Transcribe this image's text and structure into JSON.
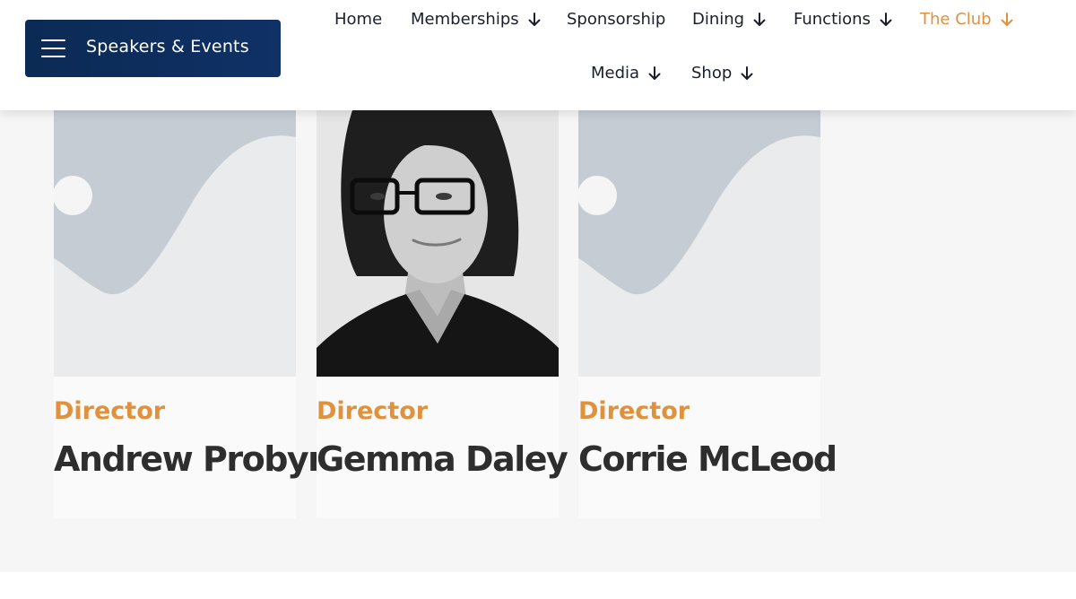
{
  "header": {
    "menu_button": {
      "label": "Speakers & Events",
      "icon": "hamburger-icon",
      "bg_color": "#0b2a54"
    },
    "nav": [
      {
        "label": "Home",
        "has_dropdown": false,
        "active": false
      },
      {
        "label": "Memberships",
        "has_dropdown": true,
        "active": false
      },
      {
        "label": "Sponsorship",
        "has_dropdown": false,
        "active": false
      },
      {
        "label": "Dining",
        "has_dropdown": true,
        "active": false
      },
      {
        "label": "Functions",
        "has_dropdown": true,
        "active": false
      },
      {
        "label": "The Club",
        "has_dropdown": true,
        "active": true
      },
      {
        "label": "Media",
        "has_dropdown": true,
        "active": false
      },
      {
        "label": "Shop",
        "has_dropdown": true,
        "active": false
      }
    ],
    "accent_color": "#e0913c"
  },
  "people": [
    {
      "role": "Director",
      "name": "Andrew Probyn",
      "image": "placeholder-avatar"
    },
    {
      "role": "Director",
      "name": "Gemma Daley",
      "image": "photo"
    },
    {
      "role": "Director",
      "name": "Corrie McLeod",
      "image": "placeholder-avatar"
    }
  ]
}
